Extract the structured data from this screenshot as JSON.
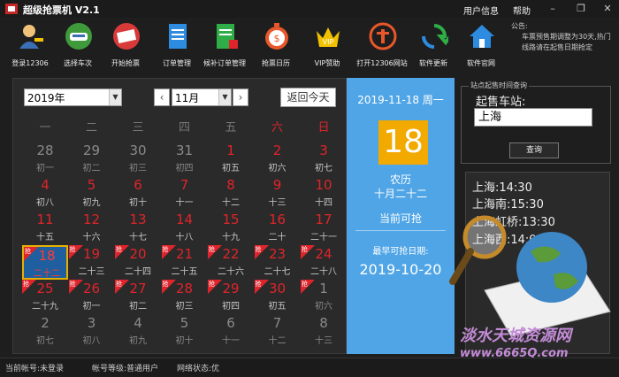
{
  "app": {
    "title": "超级抢票机 V2.1",
    "user_info": "用户信息",
    "help": "帮助"
  },
  "toolbar": [
    {
      "label": "登录12306",
      "icon": "user-key-icon"
    },
    {
      "label": "选择车次",
      "icon": "train-icon"
    },
    {
      "label": "开始抢票",
      "icon": "ticket-icon"
    },
    {
      "label": "订单管理",
      "icon": "document-icon"
    },
    {
      "label": "候补订单管理",
      "icon": "document-star-icon"
    },
    {
      "label": "抢票日历",
      "icon": "stopwatch-icon"
    },
    {
      "label": "VIP赞助",
      "icon": "vip-crown-icon"
    },
    {
      "label": "打开12306网站",
      "icon": "railway-logo-icon"
    },
    {
      "label": "软件更新",
      "icon": "refresh-icon"
    },
    {
      "label": "软件官网",
      "icon": "home-icon"
    }
  ],
  "notice": {
    "title": "公告:",
    "body": "车票预售期调整为30天,热门线路请在起售日期抢定"
  },
  "calendar": {
    "year": "2019年",
    "month": "11月",
    "today_button": "返回今天",
    "weekdays": [
      "一",
      "二",
      "三",
      "四",
      "五",
      "六",
      "日"
    ],
    "grab_mark": "抢",
    "rows": [
      [
        {
          "d": "28",
          "l": "初一",
          "t": "oth"
        },
        {
          "d": "29",
          "l": "初二",
          "t": "oth"
        },
        {
          "d": "30",
          "l": "初三",
          "t": "oth"
        },
        {
          "d": "31",
          "l": "初四",
          "t": "oth"
        },
        {
          "d": "1",
          "l": "初五",
          "t": "red"
        },
        {
          "d": "2",
          "l": "初六",
          "t": "red"
        },
        {
          "d": "3",
          "l": "初七",
          "t": "red"
        }
      ],
      [
        {
          "d": "4",
          "l": "初八",
          "t": "red"
        },
        {
          "d": "5",
          "l": "初九",
          "t": "red"
        },
        {
          "d": "6",
          "l": "初十",
          "t": "red"
        },
        {
          "d": "7",
          "l": "十一",
          "t": "red"
        },
        {
          "d": "8",
          "l": "十二",
          "t": "red"
        },
        {
          "d": "9",
          "l": "十三",
          "t": "red"
        },
        {
          "d": "10",
          "l": "十四",
          "t": "red"
        }
      ],
      [
        {
          "d": "11",
          "l": "十五",
          "t": "red"
        },
        {
          "d": "12",
          "l": "十六",
          "t": "red"
        },
        {
          "d": "13",
          "l": "十七",
          "t": "red"
        },
        {
          "d": "14",
          "l": "十八",
          "t": "red"
        },
        {
          "d": "15",
          "l": "十九",
          "t": "red"
        },
        {
          "d": "16",
          "l": "二十",
          "t": "red"
        },
        {
          "d": "17",
          "l": "二十一",
          "t": "red"
        }
      ],
      [
        {
          "d": "18",
          "l": "二十二",
          "t": "today",
          "g": true
        },
        {
          "d": "19",
          "l": "二十三",
          "t": "red",
          "g": true
        },
        {
          "d": "20",
          "l": "二十四",
          "t": "red",
          "g": true
        },
        {
          "d": "21",
          "l": "二十五",
          "t": "red",
          "g": true
        },
        {
          "d": "22",
          "l": "二十六",
          "t": "red",
          "g": true
        },
        {
          "d": "23",
          "l": "二十七",
          "t": "red",
          "g": true
        },
        {
          "d": "24",
          "l": "二十八",
          "t": "red",
          "g": true
        }
      ],
      [
        {
          "d": "25",
          "l": "二十九",
          "t": "red",
          "g": true
        },
        {
          "d": "26",
          "l": "初一",
          "t": "red",
          "g": true
        },
        {
          "d": "27",
          "l": "初二",
          "t": "red",
          "g": true
        },
        {
          "d": "28",
          "l": "初三",
          "t": "red",
          "g": true
        },
        {
          "d": "29",
          "l": "初四",
          "t": "red",
          "g": true
        },
        {
          "d": "30",
          "l": "初五",
          "t": "red",
          "g": true
        },
        {
          "d": "1",
          "l": "初六",
          "t": "oth",
          "g": true
        }
      ],
      [
        {
          "d": "2",
          "l": "初七",
          "t": "oth"
        },
        {
          "d": "3",
          "l": "初八",
          "t": "oth"
        },
        {
          "d": "4",
          "l": "初九",
          "t": "oth"
        },
        {
          "d": "5",
          "l": "初十",
          "t": "oth"
        },
        {
          "d": "6",
          "l": "十一",
          "t": "oth"
        },
        {
          "d": "7",
          "l": "十二",
          "t": "oth"
        },
        {
          "d": "8",
          "l": "十三",
          "t": "oth"
        }
      ]
    ]
  },
  "info": {
    "date": "2019-11-18 周一",
    "day": "18",
    "lunar_label": "农历",
    "lunar_date": "十月二十二",
    "status": "当前可抢",
    "earliest_label": "最早可抢日期:",
    "earliest_date": "2019-10-20"
  },
  "query": {
    "title": "站点起售时间查询",
    "label": "起售车站:",
    "value": "上海",
    "button": "查询",
    "results": [
      "上海:14:30",
      "上海南:15:30",
      "上海虹桥:13:30",
      "上海西:14:00"
    ]
  },
  "status": {
    "account": "当前帐号:未登录",
    "level": "帐号等级:普通用户",
    "network": "网络状态:优"
  },
  "watermark": {
    "line1": "淡水天城资源网",
    "line2": "www.6665Q.com"
  },
  "colors": {
    "accent_blue": "#4fa5e6",
    "today_gold": "#f2a900",
    "red": "#e0242b"
  }
}
